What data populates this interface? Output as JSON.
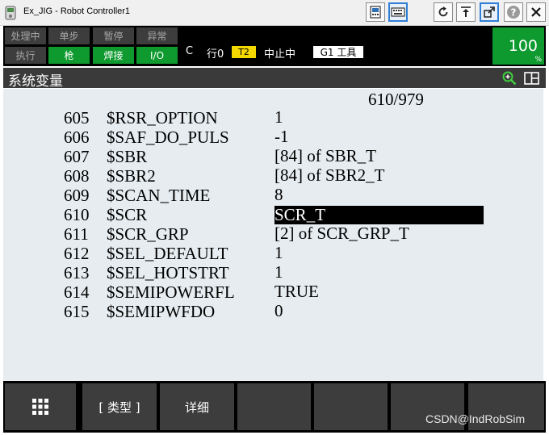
{
  "window": {
    "title": "Ex_JIG - Robot Controller1",
    "icons": [
      "app-icon",
      "tp-icon",
      "keyboard-icon",
      "refresh-icon",
      "jog-icon",
      "popout-icon",
      "help-icon",
      "close-icon"
    ]
  },
  "status": {
    "lamps_top": [
      "处理中",
      "单步",
      "暂停",
      "异常"
    ],
    "lamps_bottom": [
      "执行",
      "枪",
      "焊接",
      "I/O"
    ],
    "lamp_bottom_on": [
      false,
      true,
      true,
      true
    ],
    "mode": "C",
    "line": "行0",
    "t2_label": "T2",
    "state": "中止中",
    "tool": "G1 工具",
    "override": "100",
    "override_unit": "%",
    "colors": {
      "lamp_on": "#0e9a2e",
      "lamp_off": "#3d3d3d",
      "t2": "#f5d800",
      "override": "#0e9a2e"
    }
  },
  "screen": {
    "title": "系统变量",
    "icons": [
      "zoom-icon",
      "split-screen-icon"
    ]
  },
  "variables": {
    "counter": "610/979",
    "rows": [
      {
        "num": "605",
        "name": "$RSR_OPTION",
        "value": "1"
      },
      {
        "num": "606",
        "name": "$SAF_DO_PULS",
        "value": "-1"
      },
      {
        "num": "607",
        "name": "$SBR",
        "value": "[84] of SBR_T"
      },
      {
        "num": "608",
        "name": "$SBR2",
        "value": "[84] of SBR2_T"
      },
      {
        "num": "609",
        "name": "$SCAN_TIME",
        "value": "8"
      },
      {
        "num": "610",
        "name": "$SCR",
        "value": "SCR_T",
        "selected": true
      },
      {
        "num": "611",
        "name": "$SCR_GRP",
        "value": "[2] of SCR_GRP_T"
      },
      {
        "num": "612",
        "name": "$SEL_DEFAULT",
        "value": "1"
      },
      {
        "num": "613",
        "name": "$SEL_HOTSTRT",
        "value": "1"
      },
      {
        "num": "614",
        "name": "$SEMIPOWERFL",
        "value": "TRUE"
      },
      {
        "num": "615",
        "name": "$SEMIPWFDO",
        "value": "0"
      }
    ]
  },
  "softkeys": {
    "menu_icon": "grid-icon",
    "labels": [
      "",
      "[ 类型 ]",
      "详细",
      "",
      "",
      "",
      ""
    ]
  },
  "watermark": "CSDN@IndRobSim"
}
